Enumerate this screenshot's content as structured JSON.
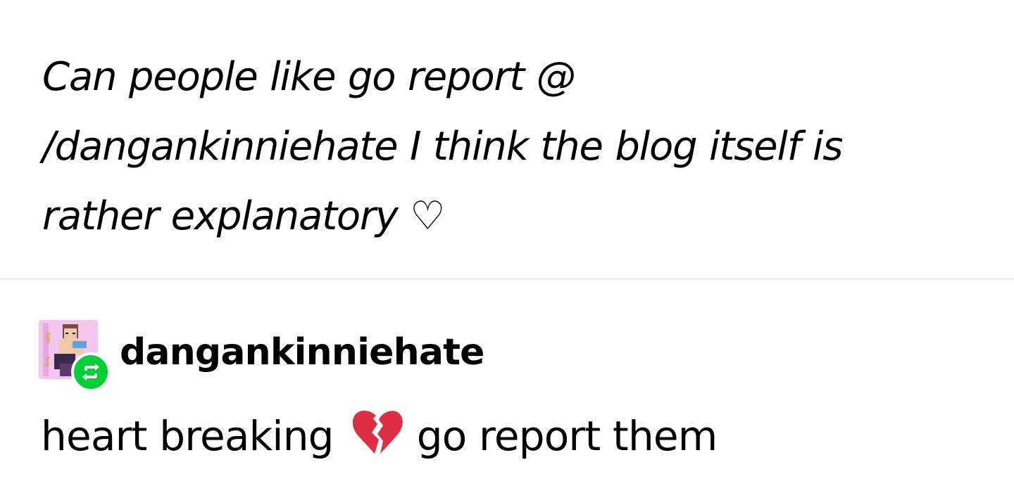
{
  "quoted_post": {
    "lines": [
      "Can people like go report @",
      "/dangankinniehate I think the blog itself is",
      "rather explanatory ♡"
    ]
  },
  "reblog": {
    "username": "dangankinniehate",
    "avatar_icon": "blog-avatar",
    "badge_icon": "reblog-icon",
    "badge_color": "#00cf35",
    "text_before_emoji": "heart breaking",
    "emoji_icon": "broken-heart-icon",
    "emoji_color": "#dd2e44",
    "text_after_emoji": "go report them"
  }
}
